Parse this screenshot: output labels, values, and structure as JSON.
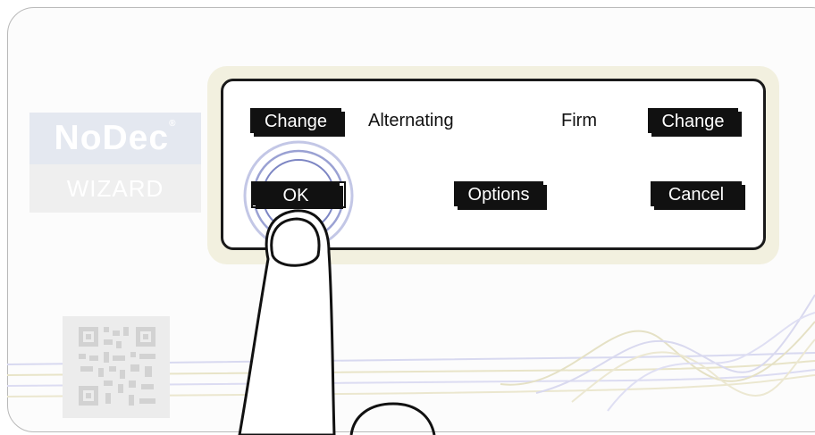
{
  "logo": {
    "brand": "NoDec",
    "mark": "®",
    "subtitle": "WIZARD"
  },
  "screen": {
    "change_left_label": "Change",
    "mode_text": "Alternating",
    "firmness_text": "Firm",
    "change_right_label": "Change",
    "ok_label": "OK",
    "options_label": "Options",
    "cancel_label": "Cancel"
  },
  "colors": {
    "button_bg": "#111111",
    "touch_ring": "#8a92c8",
    "screen_glow": "#f2f0df"
  }
}
